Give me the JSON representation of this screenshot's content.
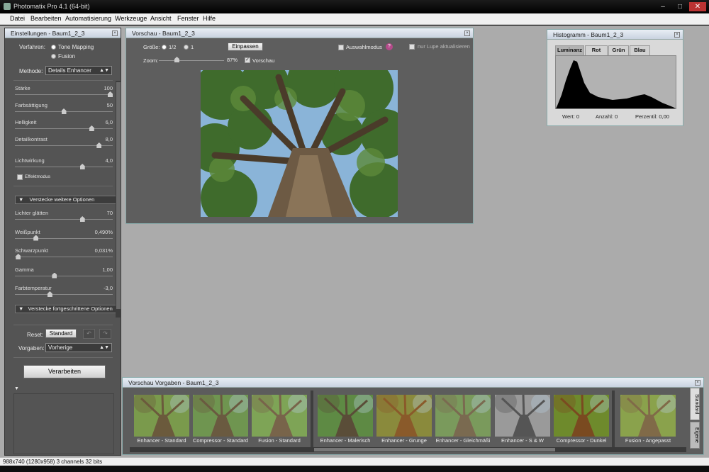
{
  "window": {
    "title": "Photomatix Pro 4.1 (64-bit)"
  },
  "menu": [
    "Datei",
    "Bearbeiten",
    "Automatisierung",
    "Werkzeuge",
    "Ansicht",
    "Fenster",
    "Hilfe"
  ],
  "settings": {
    "header": "Einstellungen - Baum1_2_3",
    "verfahren_label": "Verfahren:",
    "opt_tonemapping": "Tone Mapping",
    "opt_fusion": "Fusion",
    "methode_label": "Methode:",
    "methode_value": "Details Enhancer",
    "sliders": [
      {
        "name": "Stärke",
        "value": "100",
        "pos": 1.0
      },
      {
        "name": "Farbsättigung",
        "value": "50",
        "pos": 0.5
      },
      {
        "name": "Helligkeit",
        "value": "6,0",
        "pos": 0.8
      },
      {
        "name": "Detailkontrast",
        "value": "8,0",
        "pos": 0.88
      },
      {
        "name": "Lichtwirkung",
        "value": "4,0",
        "pos": 0.7
      }
    ],
    "effektmodus": "Effektmodus",
    "more_options": "Verstecke weitere Optionen",
    "more_sliders": [
      {
        "name": "Lichter glätten",
        "value": "70",
        "pos": 0.7
      },
      {
        "name": "Weißpunkt",
        "value": "0,490%",
        "pos": 0.2
      },
      {
        "name": "Schwarzpunkt",
        "value": "0,031%",
        "pos": 0.01
      },
      {
        "name": "Gamma",
        "value": "1,00",
        "pos": 0.4
      },
      {
        "name": "Farbtemperatur",
        "value": "-3,0",
        "pos": 0.35
      }
    ],
    "advanced_options": "Verstecke fortgeschrittene Optionen",
    "reset_label": "Reset:",
    "reset_button": "Standard",
    "vorgaben_label": "Vorgaben:",
    "vorgaben_value": "Vorherige",
    "process_button": "Verarbeiten"
  },
  "preview": {
    "header": "Vorschau - Baum1_2_3",
    "size_label": "Größe:",
    "size_half": "1/2",
    "size_one": "1",
    "fit_button": "Einpassen",
    "zoom_label": "Zoom:",
    "zoom_value": "87%",
    "vorschau_label": "Vorschau",
    "auswahl_label": "Auswahlmodus",
    "lupe_label": "nur Lupe aktualisieren",
    "help_icon": "?"
  },
  "histogram": {
    "header": "Histogramm - Baum1_2_3",
    "tabs": [
      "Luminanz",
      "Rot",
      "Grün",
      "Blau"
    ],
    "wert": "Wert: 0",
    "anzahl": "Anzahl: 0",
    "perzentil": "Perzentil: 0,00"
  },
  "presets": {
    "header": "Vorschau Vorgaben - Baum1_2_3",
    "items": [
      "Enhancer - Standard",
      "Compressor - Standard",
      "Fusion - Standard",
      "Enhancer - Malerisch",
      "Enhancer - Grunge",
      "Enhancer - Gleichmäßi",
      "Enhancer - S & W",
      "Compressor - Dunkel",
      "Fusion - Angepasst"
    ],
    "side_tabs": [
      "Standard",
      "Eigene"
    ]
  },
  "status": "988x740 (1280x958) 3 channels 32 bits"
}
